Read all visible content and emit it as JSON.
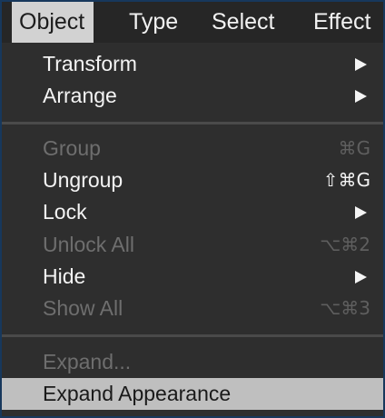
{
  "menubar": {
    "items": [
      {
        "label": "Object"
      },
      {
        "label": "Type"
      },
      {
        "label": "Select"
      },
      {
        "label": "Effect"
      }
    ]
  },
  "menu": {
    "items": [
      {
        "label": "Transform",
        "submenu": true,
        "enabled": true
      },
      {
        "label": "Arrange",
        "submenu": true,
        "enabled": true
      },
      {
        "label": "Group",
        "shortcut": "⌘G",
        "enabled": false
      },
      {
        "label": "Ungroup",
        "shortcut": "⇧⌘G",
        "enabled": true
      },
      {
        "label": "Lock",
        "submenu": true,
        "enabled": true
      },
      {
        "label": "Unlock All",
        "shortcut": "⌥⌘2",
        "enabled": false
      },
      {
        "label": "Hide",
        "submenu": true,
        "enabled": true
      },
      {
        "label": "Show All",
        "shortcut": "⌥⌘3",
        "enabled": false
      },
      {
        "label": "Expand...",
        "enabled": false
      },
      {
        "label": "Expand Appearance",
        "enabled": true,
        "highlighted": true
      }
    ]
  },
  "colors": {
    "menu_background": "#2e2e2e",
    "active_menu_title": "#d2d2d2",
    "highlighted_item": "#bfbfbf",
    "disabled_text": "#6e6e6e",
    "frame_border": "#17385c"
  }
}
